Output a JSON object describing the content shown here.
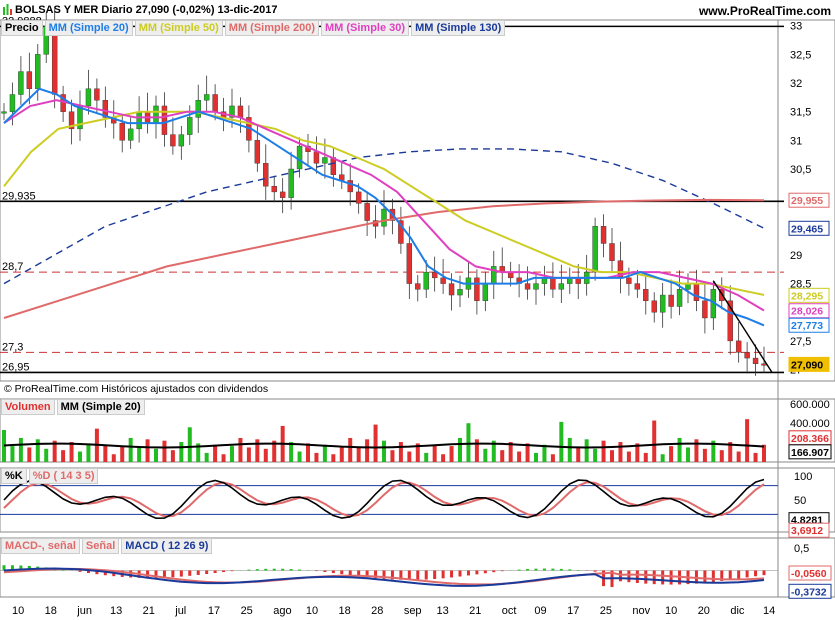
{
  "header": {
    "title": "BOLSAS Y MER  Diario  27,090 (-0,02%)  13-dic-2017",
    "site": "www.ProRealTime.com"
  },
  "legend_main": [
    "Precio",
    "MM (Simple 20)",
    "MM (Simple 50)",
    "MM (Simple 200)",
    "MM (Simple 30)",
    "MM (Simple 130)"
  ],
  "legend_vol": [
    "Volumen",
    "MM (Simple 20)"
  ],
  "legend_stoch": [
    "%K",
    "%D ( 14 3 5)"
  ],
  "legend_macd": [
    "MACD-, señal",
    "Señal",
    "MACD ( 12 26 9)"
  ],
  "note": "© ProRealTime.com Históricos ajustados con dividendos",
  "colors": {
    "up": "#22bb22",
    "down": "#e03030",
    "sma20": "#1e7ee8",
    "sma50": "#cccc22",
    "sma200": "#e06a6a",
    "sma30": "#e040c0",
    "sma130": "#1a3a9a",
    "hline": "#000000"
  },
  "chart_data": [
    {
      "type": "candlestick",
      "name": "price",
      "x": [
        "10",
        "18",
        "jun",
        "13",
        "21",
        "jul",
        "17",
        "25",
        "ago",
        "10",
        "18",
        "28",
        "sep",
        "13",
        "21",
        "oct",
        "09",
        "17",
        "25",
        "nov",
        "10",
        "20",
        "dic",
        "14"
      ],
      "ylim": [
        26.8,
        33.1
      ],
      "yticks": [
        "33",
        "32,5",
        "32",
        "31,5",
        "31",
        "30,5",
        "30",
        "29,5",
        "29",
        "28,5",
        "28",
        "27,5",
        "27"
      ],
      "level_labels": [
        "32,9888",
        "29,935",
        "28,7",
        "27,3",
        "26,95"
      ],
      "levels": [
        32.9888,
        29.935,
        28.7,
        27.3,
        26.95
      ],
      "value_tags": [
        {
          "label": "29,955",
          "series": "MM (Simple 200)"
        },
        {
          "label": "29,465",
          "series": "MM (Simple 130)"
        },
        {
          "label": "28,295",
          "series": "MM (Simple 50)"
        },
        {
          "label": "28,026",
          "series": "MM (Simple 30)"
        },
        {
          "label": "27,773",
          "series": "MM (Simple 20)"
        },
        {
          "label": "27,090",
          "series": "Precio"
        }
      ],
      "close_path": [
        31.5,
        31.8,
        32.2,
        31.9,
        32.5,
        32.99,
        31.8,
        31.5,
        31.2,
        31.6,
        31.9,
        31.7,
        31.4,
        31.3,
        31.0,
        31.2,
        31.5,
        31.3,
        31.6,
        31.1,
        30.9,
        31.1,
        31.4,
        31.7,
        31.8,
        31.5,
        31.4,
        31.6,
        31.4,
        31.0,
        30.6,
        30.2,
        30.1,
        30.0,
        30.5,
        30.9,
        30.8,
        30.6,
        30.7,
        30.4,
        30.3,
        30.1,
        29.9,
        29.6,
        29.5,
        29.8,
        29.6,
        29.2,
        28.5,
        28.4,
        28.7,
        28.6,
        28.5,
        28.3,
        28.4,
        28.6,
        28.2,
        28.5,
        28.8,
        28.7,
        28.6,
        28.5,
        28.4,
        28.5,
        28.6,
        28.4,
        28.5,
        28.6,
        28.5,
        28.7,
        29.5,
        29.2,
        28.9,
        28.6,
        28.5,
        28.4,
        28.2,
        28.0,
        28.3,
        28.1,
        28.4,
        28.5,
        28.2,
        27.9,
        28.4,
        28.2,
        27.5,
        27.3,
        27.2,
        27.1,
        27.09
      ],
      "sma20": [
        31.3,
        31.6,
        31.9,
        31.8,
        31.6,
        31.5,
        31.4,
        31.3,
        31.3,
        31.3,
        31.4,
        31.5,
        31.4,
        31.3,
        31.2,
        31.0,
        30.8,
        30.6,
        30.4,
        30.3,
        30.2,
        30.0,
        29.7,
        29.3,
        28.8,
        28.6,
        28.5,
        28.5,
        28.5,
        28.5,
        28.6,
        28.6,
        28.6,
        28.6,
        28.6,
        28.6,
        28.7,
        28.6,
        28.5,
        28.3,
        28.2,
        28.0,
        27.9,
        27.77
      ],
      "sma50": [
        30.2,
        30.8,
        31.2,
        31.3,
        31.4,
        31.5,
        31.5,
        31.5,
        31.4,
        31.3,
        31.2,
        31.0,
        30.9,
        30.7,
        30.5,
        30.2,
        29.9,
        29.6,
        29.4,
        29.2,
        29.0,
        28.8,
        28.7,
        28.7,
        28.6,
        28.5,
        28.5,
        28.4,
        28.3
      ],
      "sma200": [
        27.9,
        28.2,
        28.5,
        28.8,
        29.0,
        29.2,
        29.4,
        29.6,
        29.75,
        29.85,
        29.9,
        29.93,
        29.95,
        29.96,
        29.955
      ],
      "sma30": [
        31.3,
        31.6,
        31.7,
        31.6,
        31.5,
        31.4,
        31.4,
        31.5,
        31.5,
        31.4,
        31.2,
        31.0,
        30.8,
        30.6,
        30.4,
        30.1,
        29.6,
        29.1,
        28.8,
        28.7,
        28.7,
        28.6,
        28.6,
        28.6,
        28.7,
        28.7,
        28.6,
        28.5,
        28.3,
        28.03
      ],
      "sma130": [
        28.5,
        29.0,
        29.5,
        29.8,
        30.1,
        30.3,
        30.5,
        30.7,
        30.8,
        30.85,
        30.85,
        30.8,
        30.6,
        30.3,
        29.9,
        29.465
      ]
    },
    {
      "type": "bar",
      "name": "volume",
      "yticks": [
        "600.000",
        "400.000",
        "200.000"
      ],
      "value_tags": [
        {
          "label": "208.366",
          "series": "Volumen"
        },
        {
          "label": "166.907",
          "series": "MM (Simple 20)"
        }
      ]
    },
    {
      "type": "line",
      "name": "stochastic",
      "yticks": [
        "100",
        "50",
        "0"
      ],
      "value_tags": [
        {
          "label": "4,8281",
          "series": "%K"
        },
        {
          "label": "3,6912",
          "series": "%D"
        }
      ]
    },
    {
      "type": "line",
      "name": "macd",
      "yticks": [
        "0,5",
        "0"
      ],
      "value_tags": [
        {
          "label": "-0,0560",
          "series": "Señal"
        },
        {
          "label": "-0,3732",
          "series": "MACD"
        }
      ]
    }
  ]
}
